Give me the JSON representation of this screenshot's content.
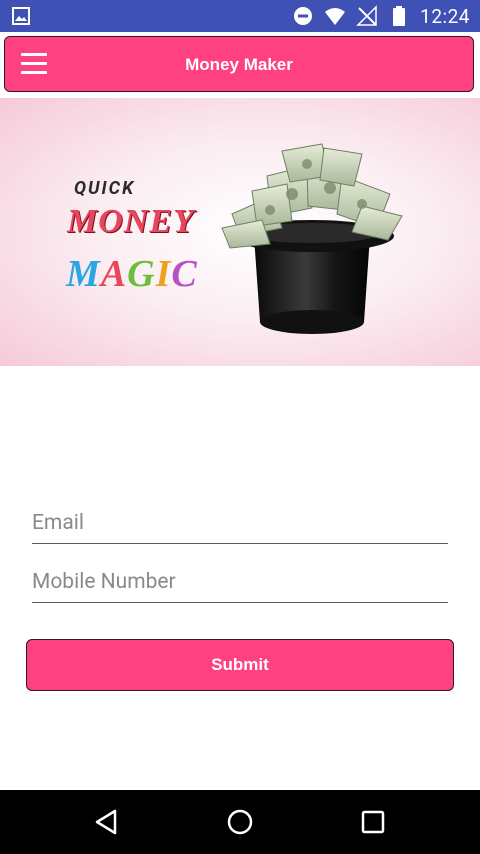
{
  "status_bar": {
    "time": "12:24",
    "icons": [
      "image-notification-icon",
      "do-not-disturb-icon",
      "wifi-icon",
      "no-signal-icon",
      "battery-icon"
    ]
  },
  "app_bar": {
    "title": "Money Maker",
    "menu_icon": "hamburger-menu-icon",
    "background": "#ff4081"
  },
  "banner": {
    "logo_line1": "QUICK",
    "logo_line2": "MONEY",
    "logo_line3": [
      "M",
      "A",
      "G",
      "I",
      "C"
    ]
  },
  "form": {
    "email": {
      "placeholder": "Email",
      "value": ""
    },
    "mobile": {
      "placeholder": "Mobile Number",
      "value": ""
    },
    "submit_label": "Submit"
  },
  "nav_bar": {
    "icons": [
      "back-icon",
      "home-icon",
      "recents-icon"
    ]
  },
  "colors": {
    "status_bar": "#3f51b5",
    "accent": "#ff4081",
    "nav_bar": "#000000"
  }
}
